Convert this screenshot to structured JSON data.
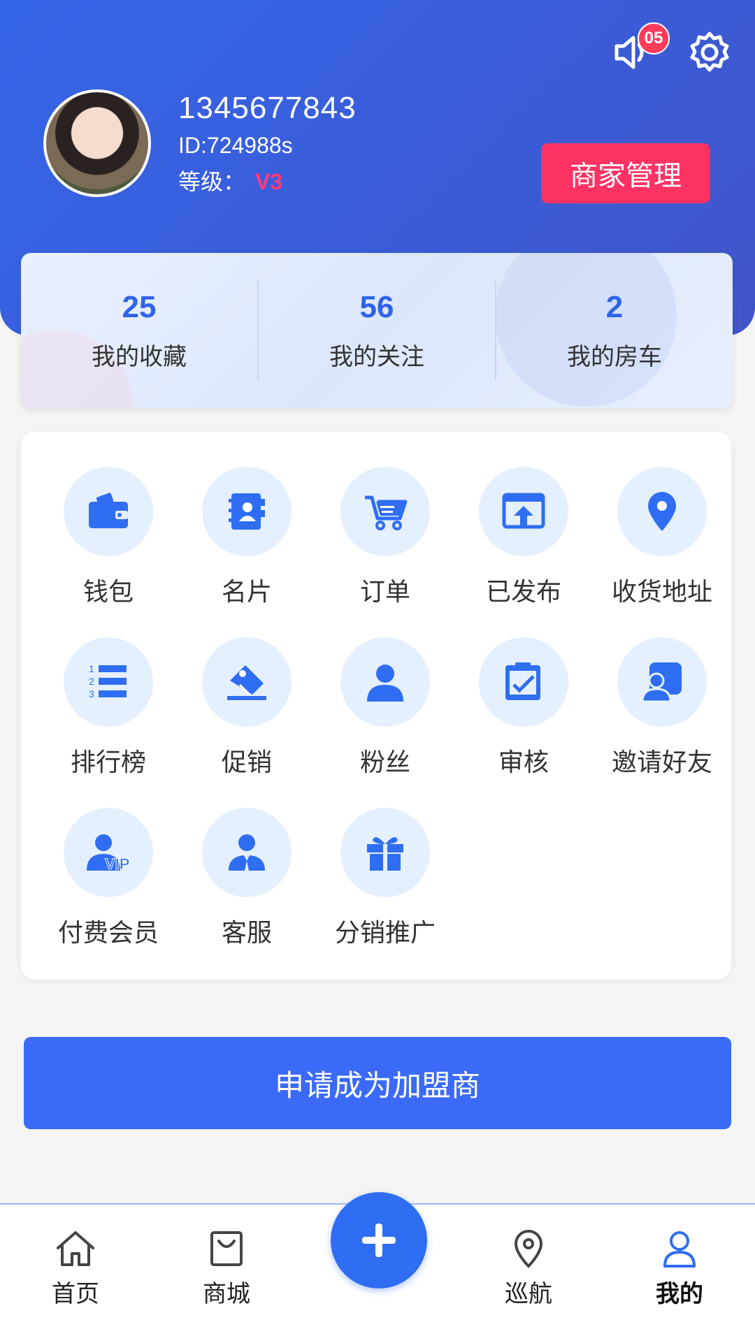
{
  "header": {
    "notification_count": "05",
    "user": {
      "phone": "1345677843",
      "id": "ID:724988s",
      "level_label": "等级：",
      "level_value": "V3"
    },
    "merchant_button": "商家管理"
  },
  "stats": [
    {
      "value": "25",
      "label": "我的收藏"
    },
    {
      "value": "56",
      "label": "我的关注"
    },
    {
      "value": "2",
      "label": "我的房车"
    }
  ],
  "menu": [
    {
      "label": "钱包",
      "icon": "wallet-icon"
    },
    {
      "label": "名片",
      "icon": "contact-card-icon"
    },
    {
      "label": "订单",
      "icon": "cart-icon"
    },
    {
      "label": "已发布",
      "icon": "publish-icon"
    },
    {
      "label": "收货地址",
      "icon": "location-pin-icon"
    },
    {
      "label": "排行榜",
      "icon": "ranking-list-icon"
    },
    {
      "label": "促销",
      "icon": "price-tag-icon"
    },
    {
      "label": "粉丝",
      "icon": "person-icon"
    },
    {
      "label": "审核",
      "icon": "clipboard-check-icon"
    },
    {
      "label": "邀请好友",
      "icon": "invite-friend-icon"
    },
    {
      "label": "付费会员",
      "icon": "vip-member-icon"
    },
    {
      "label": "客服",
      "icon": "customer-service-icon"
    },
    {
      "label": "分销推广",
      "icon": "gift-icon"
    }
  ],
  "apply_button": "申请成为加盟商",
  "tabbar": [
    {
      "label": "首页",
      "icon": "home-icon"
    },
    {
      "label": "商城",
      "icon": "shopping-bag-icon"
    },
    {
      "label": "巡航",
      "icon": "location-icon"
    },
    {
      "label": "我的",
      "icon": "user-icon"
    }
  ],
  "colors": {
    "primary": "#3a6af7",
    "accent": "#ff3264",
    "icon_bg": "#e5f0fe",
    "icon_fg": "#2f6ef2"
  }
}
